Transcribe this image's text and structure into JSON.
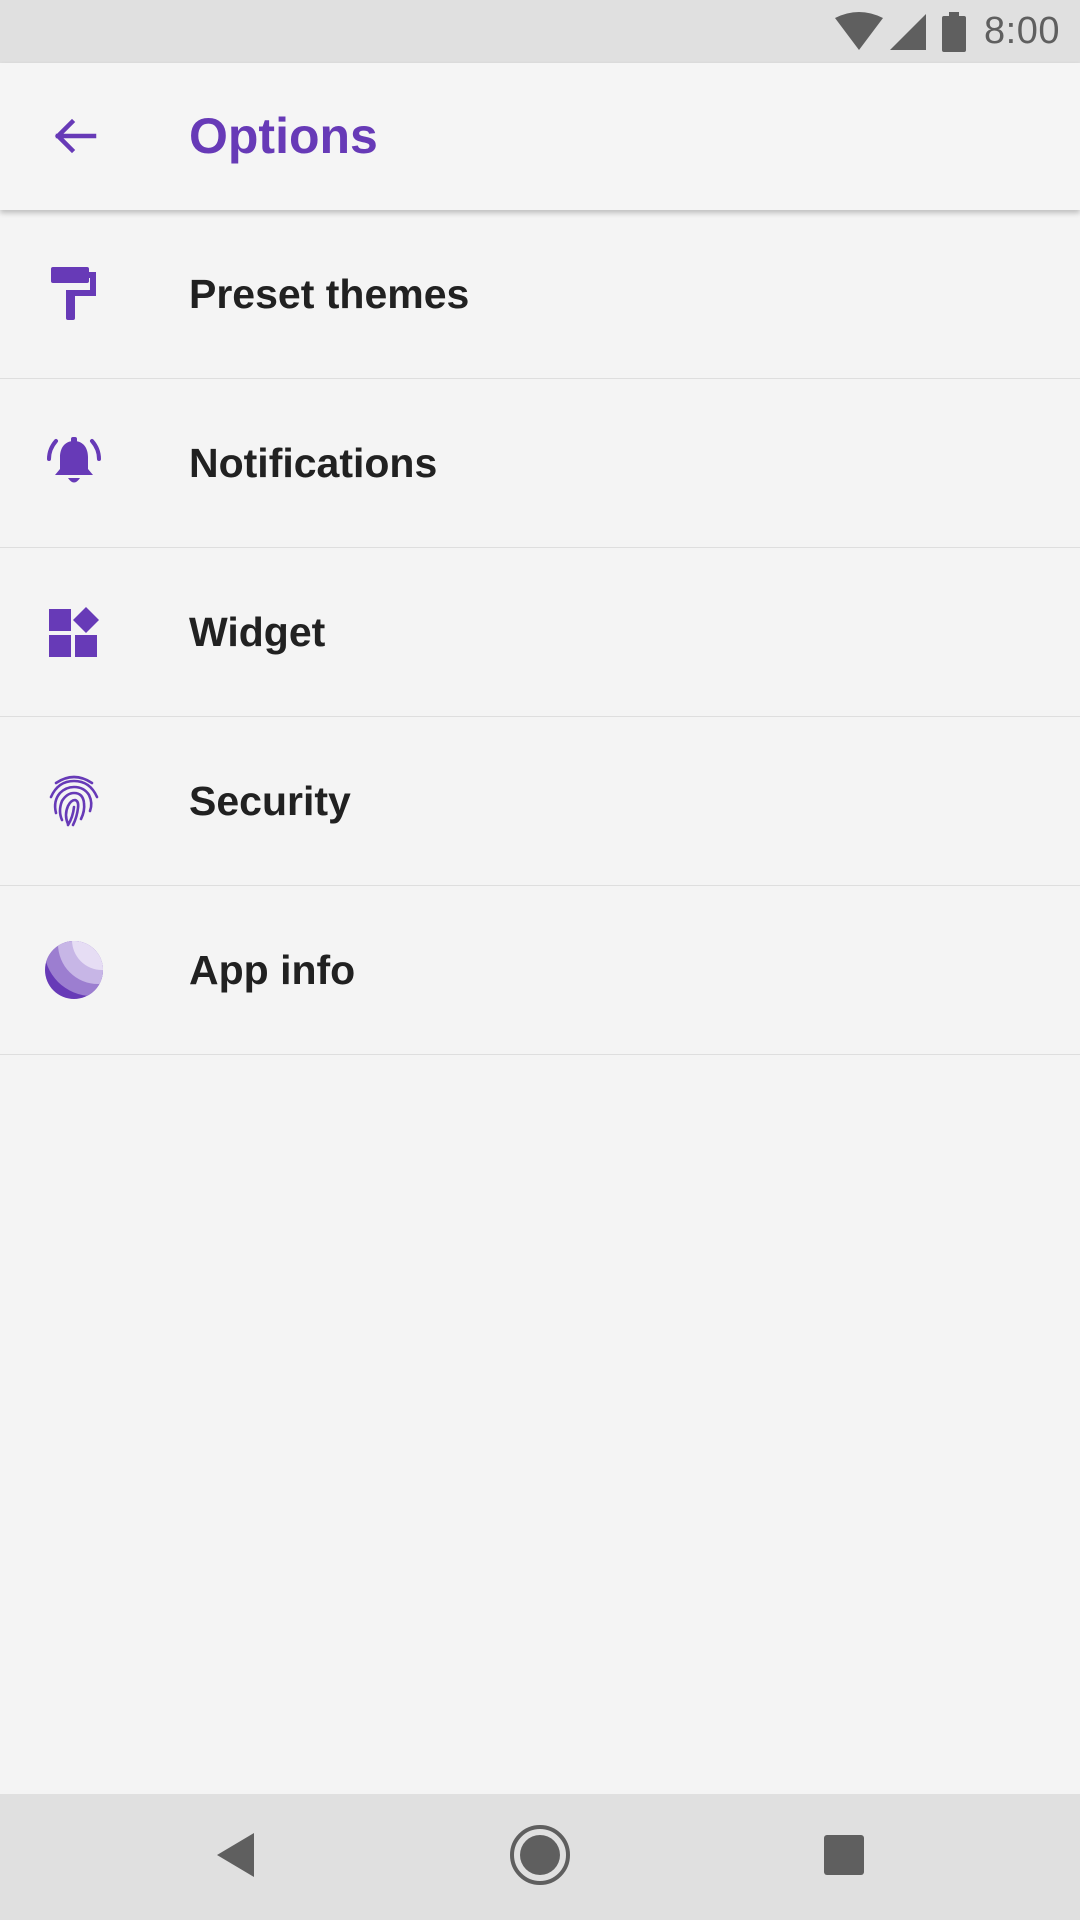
{
  "status_bar": {
    "time": "8:00",
    "icons": [
      "wifi-icon",
      "signal-icon",
      "battery-icon"
    ]
  },
  "app_bar": {
    "back_icon": "arrow-back-icon",
    "title": "Options"
  },
  "menu": {
    "items": [
      {
        "label": "Preset themes",
        "icon": "paint-roller-icon"
      },
      {
        "label": "Notifications",
        "icon": "notification-bell-icon"
      },
      {
        "label": "Widget",
        "icon": "widgets-icon"
      },
      {
        "label": "Security",
        "icon": "fingerprint-icon"
      },
      {
        "label": "App info",
        "icon": "app-logo-icon"
      }
    ]
  },
  "nav_bar": {
    "icons": [
      "nav-back-icon",
      "nav-home-icon",
      "nav-recents-icon"
    ]
  },
  "colors": {
    "accent": "#673ab7",
    "text": "#212121",
    "background": "#f4f4f4",
    "system_bar": "#e0e0e0"
  }
}
